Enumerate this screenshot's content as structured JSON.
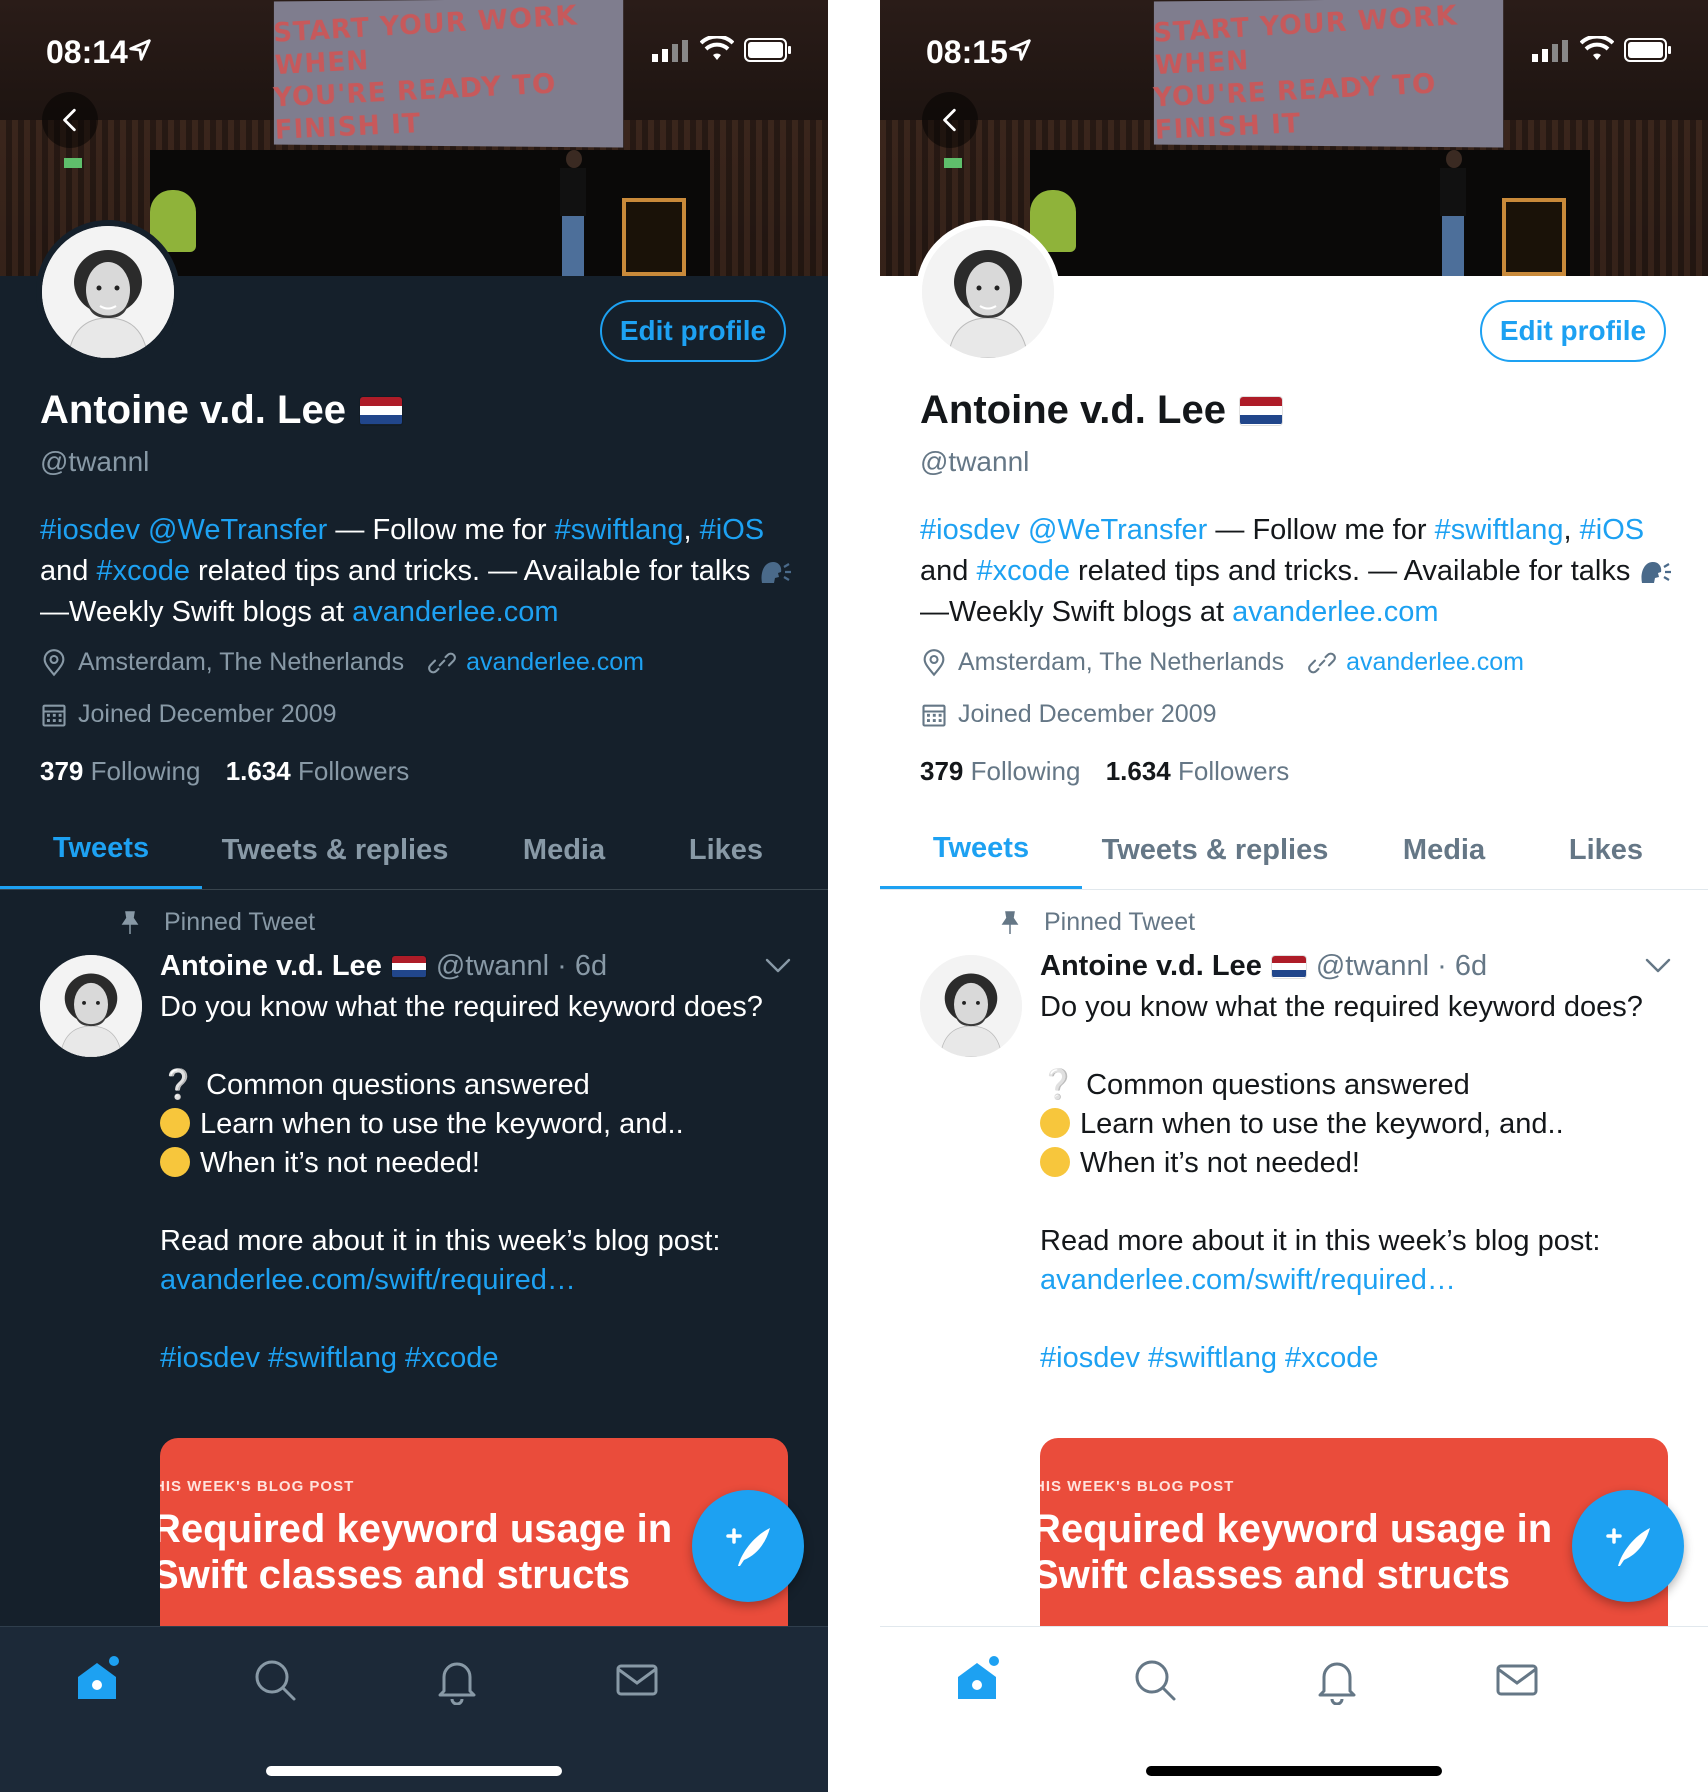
{
  "screens": [
    {
      "theme": "dark",
      "status": {
        "time": "08:14"
      },
      "header_screen": {
        "line1": "START YOUR WORK WHEN",
        "line2": "YOU'RE READY TO FINISH IT"
      },
      "profile": {
        "edit_label": "Edit profile",
        "name": "Antoine v.d. Lee",
        "handle": "@twannl",
        "bio": {
          "tag_iosdev": "#iosdev",
          "mention": "@WeTransfer",
          "text1": " — Follow me for ",
          "tag_swiftlang": "#swiftlang",
          "comma": ",",
          "tag_ios": "#iOS",
          "and": " and ",
          "tag_xcode": "#xcode",
          "text2": " related tips and tricks. — Available for talks ",
          "text3": " —Weekly Swift blogs at ",
          "url": "avanderlee.com"
        },
        "location": "Amsterdam, The Netherlands",
        "website": "avanderlee.com",
        "joined": "Joined December 2009",
        "following_count": "379",
        "following_label": "Following",
        "followers_count": "1.634",
        "followers_label": "Followers"
      },
      "tabs": [
        "Tweets",
        "Tweets & replies",
        "Media",
        "Likes"
      ],
      "tweet": {
        "pinned_label": "Pinned Tweet",
        "author": "Antoine v.d. Lee",
        "handle_time": "@twannl · 6d",
        "line1": "Do you know what the required keyword does?",
        "bullet1": "Common questions answered",
        "bullet2": "Learn when to use the keyword, and..",
        "bullet3": "When it’s not needed!",
        "read_more": "Read more about it in this week’s blog post:",
        "link": "avanderlee.com/swift/required…",
        "hashtags": "#iosdev #swiftlang #xcode",
        "card_kicker": "HIS WEEK'S BLOG POST",
        "card_title1": "Required keyword usage in",
        "card_title2": "Swift classes and structs"
      }
    },
    {
      "theme": "light",
      "status": {
        "time": "08:15"
      },
      "header_screen": {
        "line1": "START YOUR WORK WHEN",
        "line2": "YOU'RE READY TO FINISH IT"
      },
      "profile": {
        "edit_label": "Edit profile",
        "name": "Antoine v.d. Lee",
        "handle": "@twannl",
        "bio": {
          "tag_iosdev": "#iosdev",
          "mention": "@WeTransfer",
          "text1": " — Follow me for ",
          "tag_swiftlang": "#swiftlang",
          "comma": ",",
          "tag_ios": "#iOS",
          "and": " and ",
          "tag_xcode": "#xcode",
          "text2": " related tips and tricks. — Available for talks ",
          "text3": " —Weekly Swift blogs at ",
          "url": "avanderlee.com"
        },
        "location": "Amsterdam, The Netherlands",
        "website": "avanderlee.com",
        "joined": "Joined December 2009",
        "following_count": "379",
        "following_label": "Following",
        "followers_count": "1.634",
        "followers_label": "Followers"
      },
      "tabs": [
        "Tweets",
        "Tweets & replies",
        "Media",
        "Likes"
      ],
      "tweet": {
        "pinned_label": "Pinned Tweet",
        "author": "Antoine v.d. Lee",
        "handle_time": "@twannl · 6d",
        "line1": "Do you know what the required keyword does?",
        "bullet1": "Common questions answered",
        "bullet2": "Learn when to use the keyword, and..",
        "bullet3": "When it’s not needed!",
        "read_more": "Read more about it in this week’s blog post:",
        "link": "avanderlee.com/swift/required…",
        "hashtags": "#iosdev #swiftlang #xcode",
        "card_kicker": "HIS WEEK'S BLOG POST",
        "card_title1": "Required keyword usage in",
        "card_title2": "Swift classes and structs"
      }
    }
  ],
  "icons": {
    "back": "chevron-left-icon",
    "location": "location-pin-icon",
    "website": "link-icon",
    "joined": "calendar-icon",
    "pin": "pin-icon",
    "compose": "compose-tweet-icon",
    "home": "home-icon",
    "search": "search-icon",
    "notifications": "bell-icon",
    "messages": "mail-icon"
  },
  "colors": {
    "accent": "#1da1f2",
    "dark_bg": "#15202b",
    "light_bg": "#ffffff",
    "card": "#ea4c3b"
  }
}
